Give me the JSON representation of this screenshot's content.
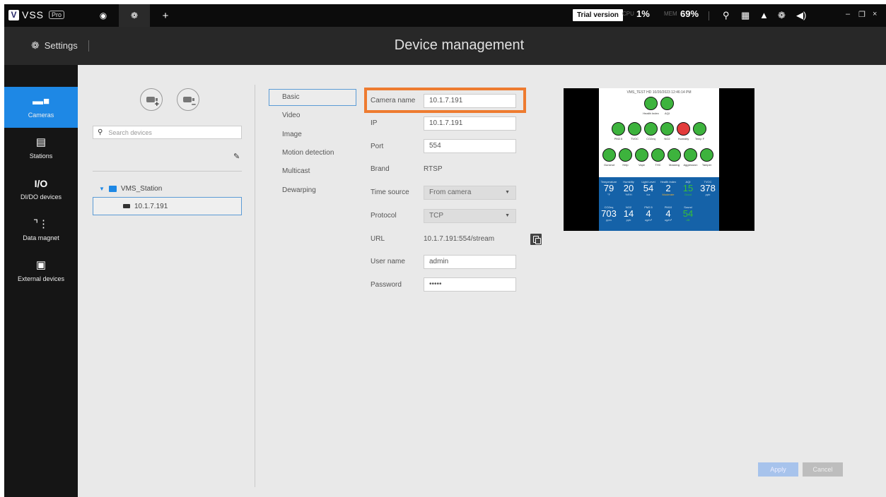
{
  "app": {
    "logo_text": "VSS",
    "logo_badge": "Pro"
  },
  "topbar": {
    "trial": "Trial version",
    "cpu_label": "CPU",
    "cpu_value": "1%",
    "mem_label": "MEM",
    "mem_value": "69%",
    "tab_icons": [
      "eye-icon",
      "gear-icon",
      "plus-icon"
    ],
    "right_icons": [
      "search-icon",
      "grid-icon",
      "bell-icon",
      "gear-icon",
      "volume-icon"
    ],
    "window_controls": [
      "minimize-icon",
      "restore-icon",
      "close-icon"
    ]
  },
  "header": {
    "settings_label": "Settings",
    "title": "Device management"
  },
  "sidenav": {
    "items": [
      {
        "label": "Cameras",
        "icon": "camera-icon"
      },
      {
        "label": "Stations",
        "icon": "server-icon"
      },
      {
        "label": "DI/DO devices",
        "icon_text": "I/O"
      },
      {
        "label": "Data magnet",
        "icon": "magnet-icon"
      },
      {
        "label": "External devices",
        "icon": "external-device-icon"
      }
    ]
  },
  "tree": {
    "search_placeholder": "Search devices",
    "station_name": "VMS_Station",
    "camera_name": "10.1.7.191"
  },
  "subtabs": [
    "Basic",
    "Video",
    "Image",
    "Motion detection",
    "Multicast",
    "Dewarping"
  ],
  "form": {
    "camera_name": {
      "label": "Camera name",
      "value": "10.1.7.191"
    },
    "ip": {
      "label": "IP",
      "value": "10.1.7.191"
    },
    "port": {
      "label": "Port",
      "value": "554"
    },
    "brand": {
      "label": "Brand",
      "value": "RTSP"
    },
    "time_source": {
      "label": "Time source",
      "value": "From camera"
    },
    "protocol": {
      "label": "Protocol",
      "value": "TCP"
    },
    "url": {
      "label": "URL",
      "value": "10.1.7.191:554/stream"
    },
    "user_name": {
      "label": "User name",
      "value": "admin"
    },
    "password": {
      "label": "Password",
      "value": "•••••"
    }
  },
  "preview": {
    "timestamp": "VMS_TEST HD 10/20/2023 12:46:14 PM",
    "row1": [
      "Health Index",
      "AQI"
    ],
    "row2": [
      "PM2.5",
      "TVOC",
      "CO2eq",
      "NO2",
      "Humidity",
      "Temp F"
    ],
    "row3": [
      "Gunshot",
      "Help",
      "Vape",
      "THC",
      "Masking",
      "Aggression",
      "Tamper"
    ],
    "readings_top": [
      {
        "h": "Temperature",
        "v": "79",
        "u": "°F"
      },
      {
        "h": "Humidity",
        "v": "20",
        "u": "%RH"
      },
      {
        "h": "Light Level",
        "v": "54",
        "u": "lux"
      },
      {
        "h": "Health Index",
        "v": "2",
        "u": "Moderate"
      },
      {
        "h": "AQI",
        "v": "15",
        "u": "Good"
      },
      {
        "h": "TVOC",
        "v": "378",
        "u": "ppb"
      }
    ],
    "readings_bottom": [
      {
        "h": "CO2eq",
        "v": "703",
        "u": "ppm"
      },
      {
        "h": "NO2",
        "v": "14",
        "u": "ppb"
      },
      {
        "h": "PM2.5",
        "v": "4",
        "u": "ug/m³"
      },
      {
        "h": "PM10",
        "v": "4",
        "u": "ug/m³"
      },
      {
        "h": "Sound",
        "v": "54",
        "u": "dB"
      }
    ]
  },
  "actions": {
    "apply": "Apply",
    "cancel": "Cancel"
  },
  "colors": {
    "accent": "#1e88e5",
    "highlight": "#ee7b30",
    "sensor_ok": "#3db33d",
    "sensor_alert": "#e33b3b",
    "panel_blue": "#1562a8"
  }
}
